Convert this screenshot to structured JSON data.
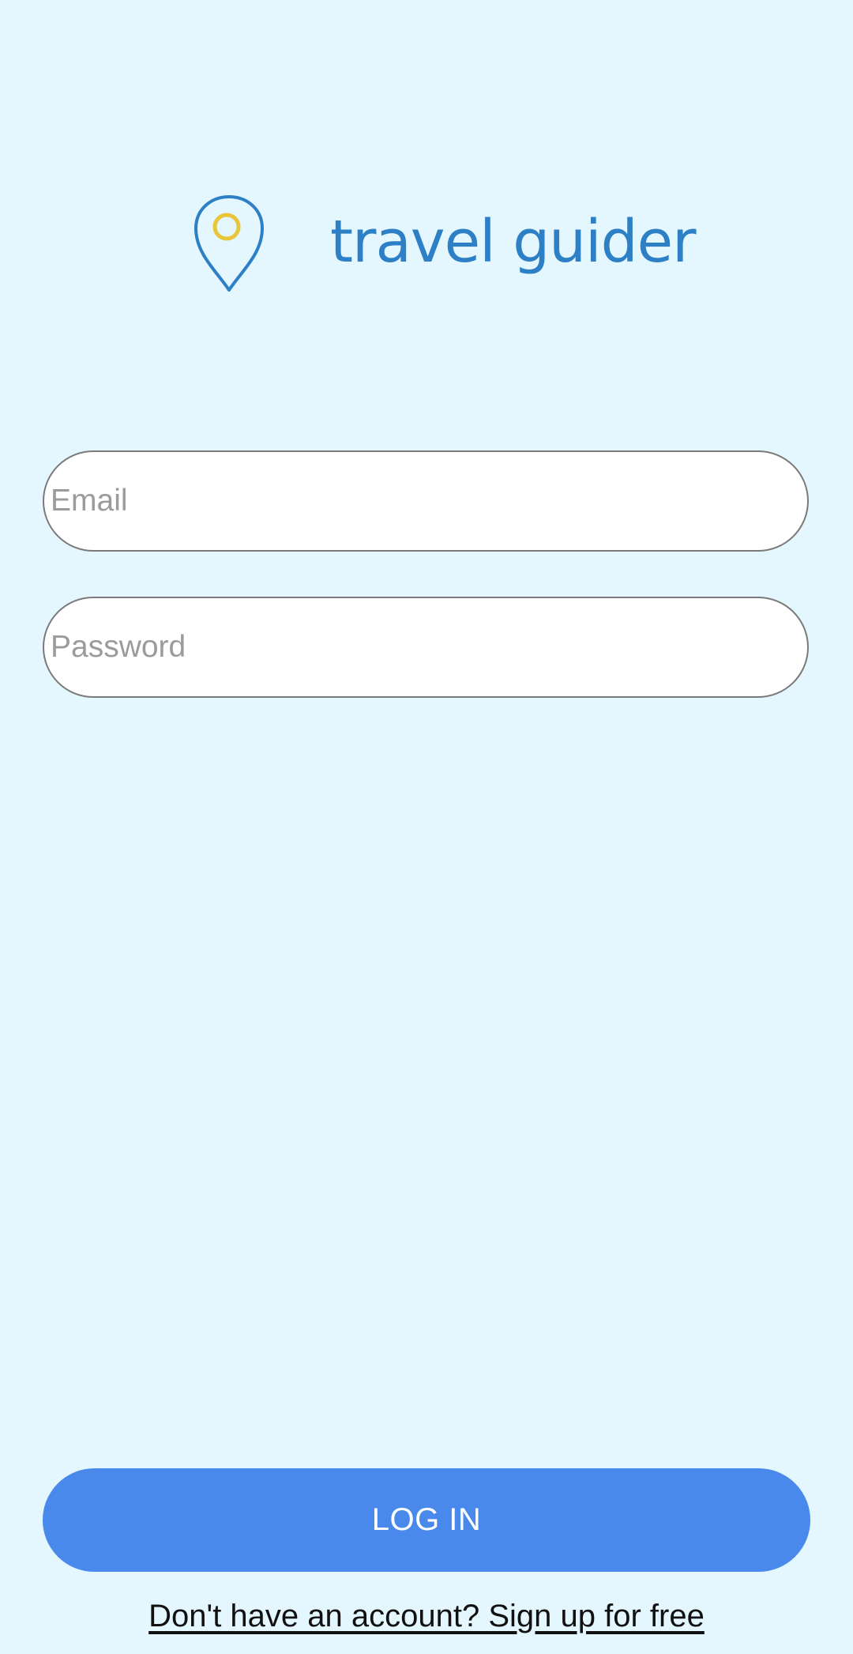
{
  "logo": {
    "icon": "map-pin-icon",
    "text": "travel guider",
    "colors": {
      "primary": "#2d7fc6",
      "accent": "#e9c53a"
    }
  },
  "form": {
    "email": {
      "placeholder": "Email",
      "value": ""
    },
    "password": {
      "placeholder": "Password",
      "value": ""
    },
    "login_label": "LOG IN",
    "signup_text": "Don't have an account? Sign up for free"
  },
  "colors": {
    "background": "#e4f7fe",
    "button": "#4a89ec",
    "field_border": "#7a7a7a",
    "placeholder": "#9b9b9b"
  }
}
